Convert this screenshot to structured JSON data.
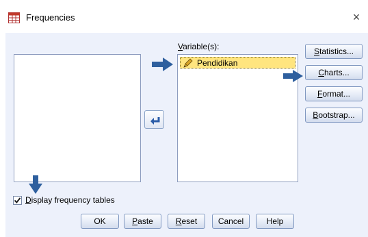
{
  "window": {
    "title": "Frequencies",
    "close_glyph": "×"
  },
  "variables_label": {
    "pre": "",
    "accel": "V",
    "post": "ariable(s):"
  },
  "selected_variables": [
    {
      "name": "Pendidikan",
      "icon": "ruler-pencil-icon"
    }
  ],
  "side_buttons": [
    {
      "pre": "",
      "accel": "S",
      "post": "tatistics..."
    },
    {
      "pre": "",
      "accel": "C",
      "post": "harts..."
    },
    {
      "pre": "",
      "accel": "F",
      "post": "ormat..."
    },
    {
      "pre": "",
      "accel": "B",
      "post": "ootstrap..."
    }
  ],
  "display_frequency_tables": {
    "checked": true,
    "pre": "",
    "accel": "D",
    "post": "isplay frequency tables"
  },
  "bottom_buttons": [
    {
      "pre": "OK",
      "accel": "",
      "post": ""
    },
    {
      "pre": "",
      "accel": "P",
      "post": "aste"
    },
    {
      "pre": "",
      "accel": "R",
      "post": "eset"
    },
    {
      "pre": "Cancel",
      "accel": "",
      "post": ""
    },
    {
      "pre": "Help",
      "accel": "",
      "post": ""
    }
  ],
  "colors": {
    "dialog_background": "#edf1fb",
    "highlight": "#ffe57f",
    "annotation_arrow": "#2e5f9e",
    "button_border": "#7f97c0"
  }
}
